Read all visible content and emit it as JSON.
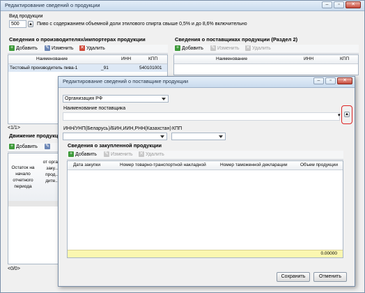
{
  "main_window": {
    "title": "Редактирование сведений о продукции",
    "product_type_label": "Вид продукции",
    "product_type_code": "500",
    "product_type_desc": "Пиво с содержанием объемной доли этилового спирта свыше 0,5% и до 8,6% включительно",
    "producers_section": "Сведения о производителях/импортерах продукции",
    "suppliers_section": "Сведения о поставщиках продукции (Раздел 2)",
    "movement_section": "Движение продукции",
    "add_label": "Добавить",
    "edit_label": "Изменить",
    "delete_label": "Удалить",
    "producers_columns": [
      "Наименование",
      "ИНН",
      "КПП"
    ],
    "producers_rows": [
      {
        "name": "Тестовый производитель пива-1",
        "inn": "_91",
        "kpp": "540101001"
      }
    ],
    "suppliers_columns": [
      "Наименование",
      "ИНН",
      "КПП"
    ],
    "producers_pager": "<1/1>",
    "movement_pager": "<0/0>",
    "movement_columns": [
      "Остаток на начало отчетного периода",
      "от орга... заку... прод... дите..."
    ]
  },
  "dialog": {
    "title": "Редактирование сведений о поставщике продукции",
    "org_type": "Организация РФ",
    "supplier_name_label": "Наименование поставщика",
    "supplier_name_value": "",
    "inn_label": "ИНН/УНП(Беларусь)/БИН,ИИН,РНН(Казахстан)",
    "kpp_label": "КПП",
    "purchase_section": "Сведения о закупленной продукции",
    "add_label": "Добавить",
    "edit_label": "Изменить",
    "delete_label": "Удалить",
    "columns": [
      "Дата закупки",
      "Номер товарно-транспортной накладной",
      "Номер таможенной декларации",
      "Объем продукции"
    ],
    "total_value": "0.00000",
    "save_label": "Сохранить",
    "cancel_label": "Отменить"
  }
}
